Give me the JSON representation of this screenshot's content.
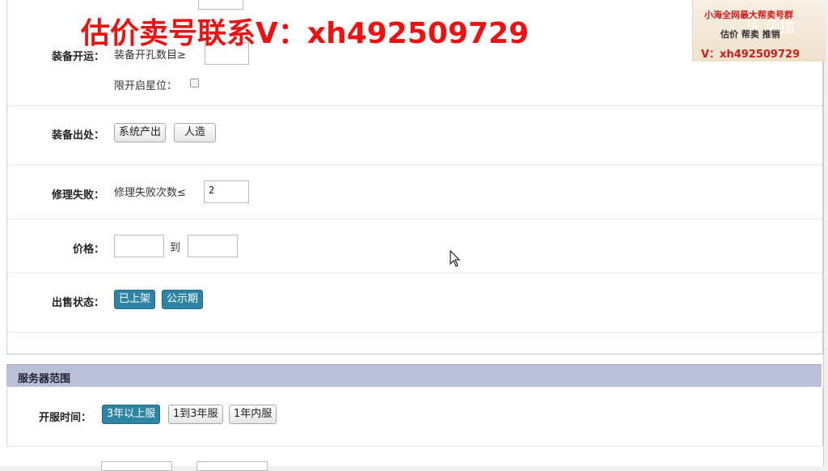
{
  "watermark": {
    "contact": "估价卖号联系V：xh492509729",
    "corner_line1": "小海全网最大帮卖号群",
    "corner_line2": "估价 帮卖 推销",
    "corner_line3": "V：xh492509729",
    "corner_wm": "泳 函描"
  },
  "form": {
    "equip_open": {
      "label": "装备开运：",
      "holes_text": "装备开孔数目≥",
      "holes_value": "",
      "star_text": "限开启星位："
    },
    "equip_source": {
      "label": "装备出处：",
      "options": [
        "系统产出",
        "人造"
      ]
    },
    "repair_fail": {
      "label": "修理失败：",
      "text": "修理失败次数≤",
      "value": "2"
    },
    "price": {
      "label": "价格：",
      "to": "到",
      "min": "",
      "max": ""
    },
    "sale_status": {
      "label": "出售状态：",
      "options": [
        "已上架",
        "公示期"
      ]
    }
  },
  "server_section": {
    "title": "服务器范围",
    "open_time": {
      "label": "开服时间：",
      "options": [
        "3年以上服",
        "1到3年服",
        "1年内服"
      ],
      "selected": "3年以上服"
    }
  },
  "colors": {
    "accent": "#2d85a3",
    "section_header": "#b9c0d8",
    "overlay_red": "#ee1111"
  }
}
